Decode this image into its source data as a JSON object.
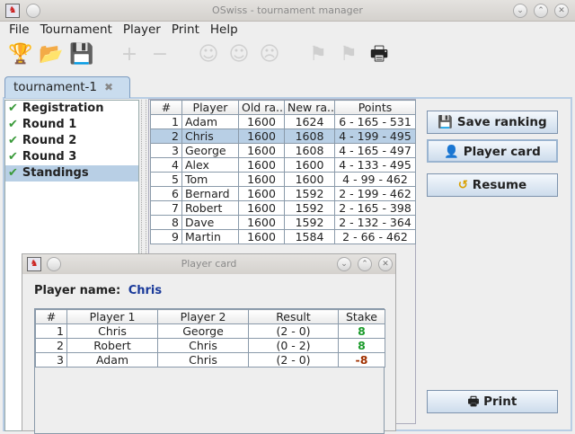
{
  "window": {
    "title": "OSwiss - tournament manager"
  },
  "menu": [
    "File",
    "Tournament",
    "Player",
    "Print",
    "Help"
  ],
  "toolbar": [
    {
      "icon": "trophy-icon",
      "glyph": "🏆",
      "enabled": true
    },
    {
      "icon": "open-icon",
      "glyph": "📂",
      "enabled": true
    },
    {
      "icon": "save-icon",
      "glyph": "💾",
      "enabled": true
    },
    {
      "icon": "add-icon",
      "glyph": "+",
      "enabled": false
    },
    {
      "icon": "remove-icon",
      "glyph": "−",
      "enabled": false
    },
    {
      "icon": "happy-face-icon",
      "glyph": "☺",
      "enabled": false
    },
    {
      "icon": "neutral-face-icon",
      "glyph": "☺",
      "enabled": false
    },
    {
      "icon": "sad-face-icon",
      "glyph": "☹",
      "enabled": false
    },
    {
      "icon": "flag-icon",
      "glyph": "⚑",
      "enabled": false
    },
    {
      "icon": "flag-icon",
      "glyph": "⚑",
      "enabled": false
    },
    {
      "icon": "printer-icon",
      "glyph": "🖶",
      "enabled": true
    }
  ],
  "tab": {
    "label": "tournament-1",
    "close": "✖"
  },
  "tree": [
    {
      "label": "Registration",
      "selected": false
    },
    {
      "label": "Round 1",
      "selected": false
    },
    {
      "label": "Round 2",
      "selected": false
    },
    {
      "label": "Round 3",
      "selected": false
    },
    {
      "label": "Standings",
      "selected": true
    }
  ],
  "standings": {
    "columns": [
      "#",
      "Player",
      "Old ra...",
      "New ra...",
      "Points"
    ],
    "rows": [
      [
        "1",
        "Adam",
        "1600",
        "1624",
        "6 - 165 - 531"
      ],
      [
        "2",
        "Chris",
        "1600",
        "1608",
        "4 - 199 - 495"
      ],
      [
        "3",
        "George",
        "1600",
        "1608",
        "4 - 165 - 497"
      ],
      [
        "4",
        "Alex",
        "1600",
        "1600",
        "4 - 133 - 495"
      ],
      [
        "5",
        "Tom",
        "1600",
        "1600",
        "4 - 99 - 462"
      ],
      [
        "6",
        "Bernard",
        "1600",
        "1592",
        "2 - 199 - 462"
      ],
      [
        "7",
        "Robert",
        "1600",
        "1592",
        "2 - 165 - 398"
      ],
      [
        "8",
        "Dave",
        "1600",
        "1592",
        "2 - 132 - 364"
      ],
      [
        "9",
        "Martin",
        "1600",
        "1584",
        "2 - 66 - 462"
      ]
    ],
    "selected_row": 1
  },
  "buttons": {
    "save_ranking": "Save ranking",
    "player_card": "Player card",
    "resume": "Resume",
    "print": "Print"
  },
  "dialog": {
    "title": "Player card",
    "name_label": "Player name:",
    "name_value": "Chris",
    "columns": [
      "#",
      "Player 1",
      "Player 2",
      "Result",
      "Stake"
    ],
    "rows": [
      [
        "1",
        "Chris",
        "George",
        "(2 - 0)",
        "8"
      ],
      [
        "2",
        "Robert",
        "Chris",
        "(0 - 2)",
        "8"
      ],
      [
        "3",
        "Adam",
        "Chris",
        "(2 - 0)",
        "-8"
      ]
    ],
    "colors": {
      "positive": "#1a9a2a",
      "negative": "#a03000",
      "name": "#1a3a9a"
    }
  }
}
